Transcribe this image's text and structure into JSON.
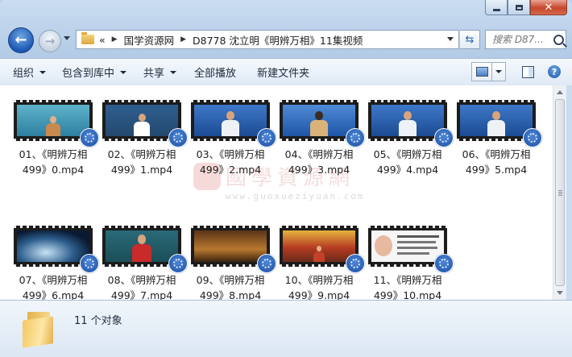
{
  "window": {
    "colors": {
      "frame": "#b9d1ea",
      "close": "#c7462c",
      "accent": "#1d58b4"
    }
  },
  "nav": {
    "breadcrumb_prefix": "«",
    "crumbs": [
      "国学资源网",
      "D8778 沈立明《明辨万相》11集视频"
    ],
    "search_placeholder": "搜索 D87..."
  },
  "toolbar": {
    "organize": "组织",
    "include_library": "包含到库中",
    "share": "共享",
    "play_all": "全部播放",
    "new_folder": "新建文件夹"
  },
  "files": [
    {
      "name": "01、《明辨万相\n499》0.mp4",
      "scene": "teal-studio"
    },
    {
      "name": "02、《明辨万相\n499》1.mp4",
      "scene": "blackboard"
    },
    {
      "name": "03、《明辨万相\n499》2.mp4",
      "scene": "blue-studio"
    },
    {
      "name": "04、《明辨万相\n499》3.mp4",
      "scene": "blue-studio-woman"
    },
    {
      "name": "05、《明辨万相\n499》4.mp4",
      "scene": "blue-studio"
    },
    {
      "name": "06、《明辨万相\n499》5.mp4",
      "scene": "blue-studio"
    },
    {
      "name": "07、《明辨万相\n499》6.mp4",
      "scene": "space"
    },
    {
      "name": "08、《明辨万相\n499》7.mp4",
      "scene": "red-shirt-board"
    },
    {
      "name": "09、《明辨万相\n499》8.mp4",
      "scene": "library"
    },
    {
      "name": "10、《明辨万相\n499》9.mp4",
      "scene": "palace"
    },
    {
      "name": "11、《明辨万相\n499》10.mp4",
      "scene": "slide"
    }
  ],
  "status": {
    "count": "11 个对象"
  },
  "watermark": {
    "text": "國學資源網",
    "sub": "www.guoxueziyuan.com"
  }
}
